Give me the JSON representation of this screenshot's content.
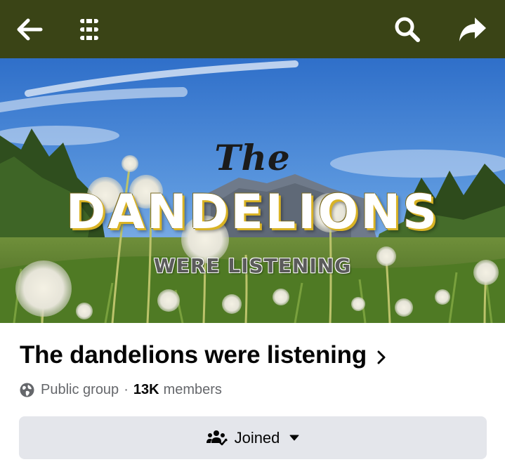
{
  "header": {
    "icons": [
      "back-arrow-icon",
      "list-menu-icon",
      "search-icon",
      "share-arrow-icon"
    ],
    "background_color": "#3a4416"
  },
  "cover": {
    "line1": "The",
    "line2": "DANDELIONS",
    "line3": "WERE LISTENING"
  },
  "group": {
    "name": "The dandelions were listening",
    "privacy": "Public group",
    "separator": "·",
    "member_count": "13K",
    "member_label": "members"
  },
  "actions": {
    "joined_label": "Joined",
    "joined_icon": "group-check-icon",
    "dropdown_icon": "caret-down-icon"
  }
}
